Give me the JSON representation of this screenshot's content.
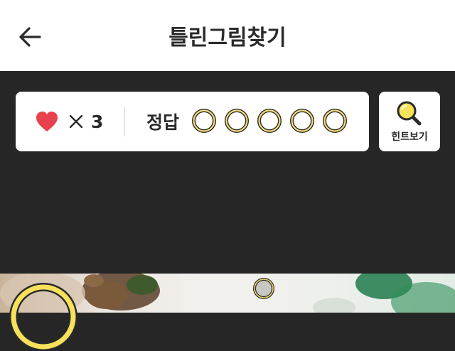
{
  "header": {
    "title": "틀린그림찾기",
    "back_icon": "arrow-left-icon"
  },
  "status": {
    "lives_icon": "heart-icon",
    "lives_color": "#e8414e",
    "times_icon": "multiply-icon",
    "lives_count": "3",
    "answers_label": "정답",
    "answer_slots": [
      {
        "icon": "empty-ring-icon",
        "found": false
      },
      {
        "icon": "empty-ring-icon",
        "found": false
      },
      {
        "icon": "empty-ring-icon",
        "found": false
      },
      {
        "icon": "empty-ring-icon",
        "found": false
      },
      {
        "icon": "empty-ring-icon",
        "found": false
      }
    ],
    "ring_color": "#f5dc78"
  },
  "hint_button": {
    "icon": "magnifier-icon",
    "label": "힌트보기"
  },
  "colors": {
    "background": "#262626",
    "card": "#ffffff",
    "accent_yellow": "#f7e15a",
    "text": "#2a2a2a"
  }
}
